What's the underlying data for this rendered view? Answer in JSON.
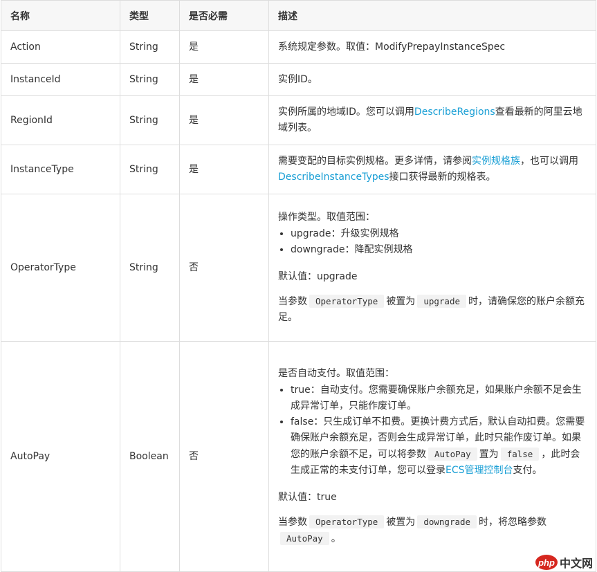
{
  "headers": {
    "name": "名称",
    "type": "类型",
    "required": "是否必需",
    "desc": "描述"
  },
  "rows": [
    {
      "name": "Action",
      "type": "String",
      "required": "是",
      "desc": "系统规定参数。取值：ModifyPrepayInstanceSpec"
    },
    {
      "name": "InstanceId",
      "type": "String",
      "required": "是",
      "desc": "实例ID。"
    },
    {
      "name": "RegionId",
      "type": "String",
      "required": "是",
      "desc_a": "实例所属的地域ID。您可以调用",
      "link": "DescribeRegions",
      "desc_b": "查看最新的阿里云地域列表。"
    },
    {
      "name": "InstanceType",
      "type": "String",
      "required": "是",
      "desc_a": "需要变配的目标实例规格。更多详情，请参阅",
      "link1": "实例规格族",
      "desc_b": "，也可以调用",
      "link2": "DescribeInstanceTypes",
      "desc_c": "接口获得最新的规格表。"
    },
    {
      "name": "OperatorType",
      "type": "String",
      "required": "否",
      "intro": "操作类型。取值范围：",
      "items": [
        "upgrade：升级实例规格",
        "downgrade：降配实例规格"
      ],
      "default": "默认值：upgrade",
      "note_a": "当参数",
      "note_code1": "OperatorType",
      "note_b": "被置为",
      "note_code2": "upgrade",
      "note_c": "时，请确保您的账户余额充足。"
    },
    {
      "name": "AutoPay",
      "type": "Boolean",
      "required": "否",
      "intro": "是否自动支付。取值范围：",
      "item1": "true：自动支付。您需要确保账户余额充足，如果账户余额不足会生成异常订单，只能作废订单。",
      "item2_a": "false：只生成订单不扣费。更换计费方式后，默认自动扣费。您需要确保账户余额充足，否则会生成异常订单，此时只能作废订单。如果您的账户余额不足，可以将参数",
      "item2_code1": "AutoPay",
      "item2_b": "置为",
      "item2_code2": "false",
      "item2_c": "，此时会生成正常的未支付订单，您可以登录",
      "item2_link": "ECS管理控制台",
      "item2_d": "支付。",
      "default": "默认值：true",
      "note_a": "当参数",
      "note_code1": "OperatorType",
      "note_b": "被置为",
      "note_code2": "downgrade",
      "note_c": "时，将忽略参数",
      "note_code3": "AutoPay",
      "note_d": "。"
    }
  ],
  "watermark": {
    "logo": "php",
    "text": "中文网"
  }
}
